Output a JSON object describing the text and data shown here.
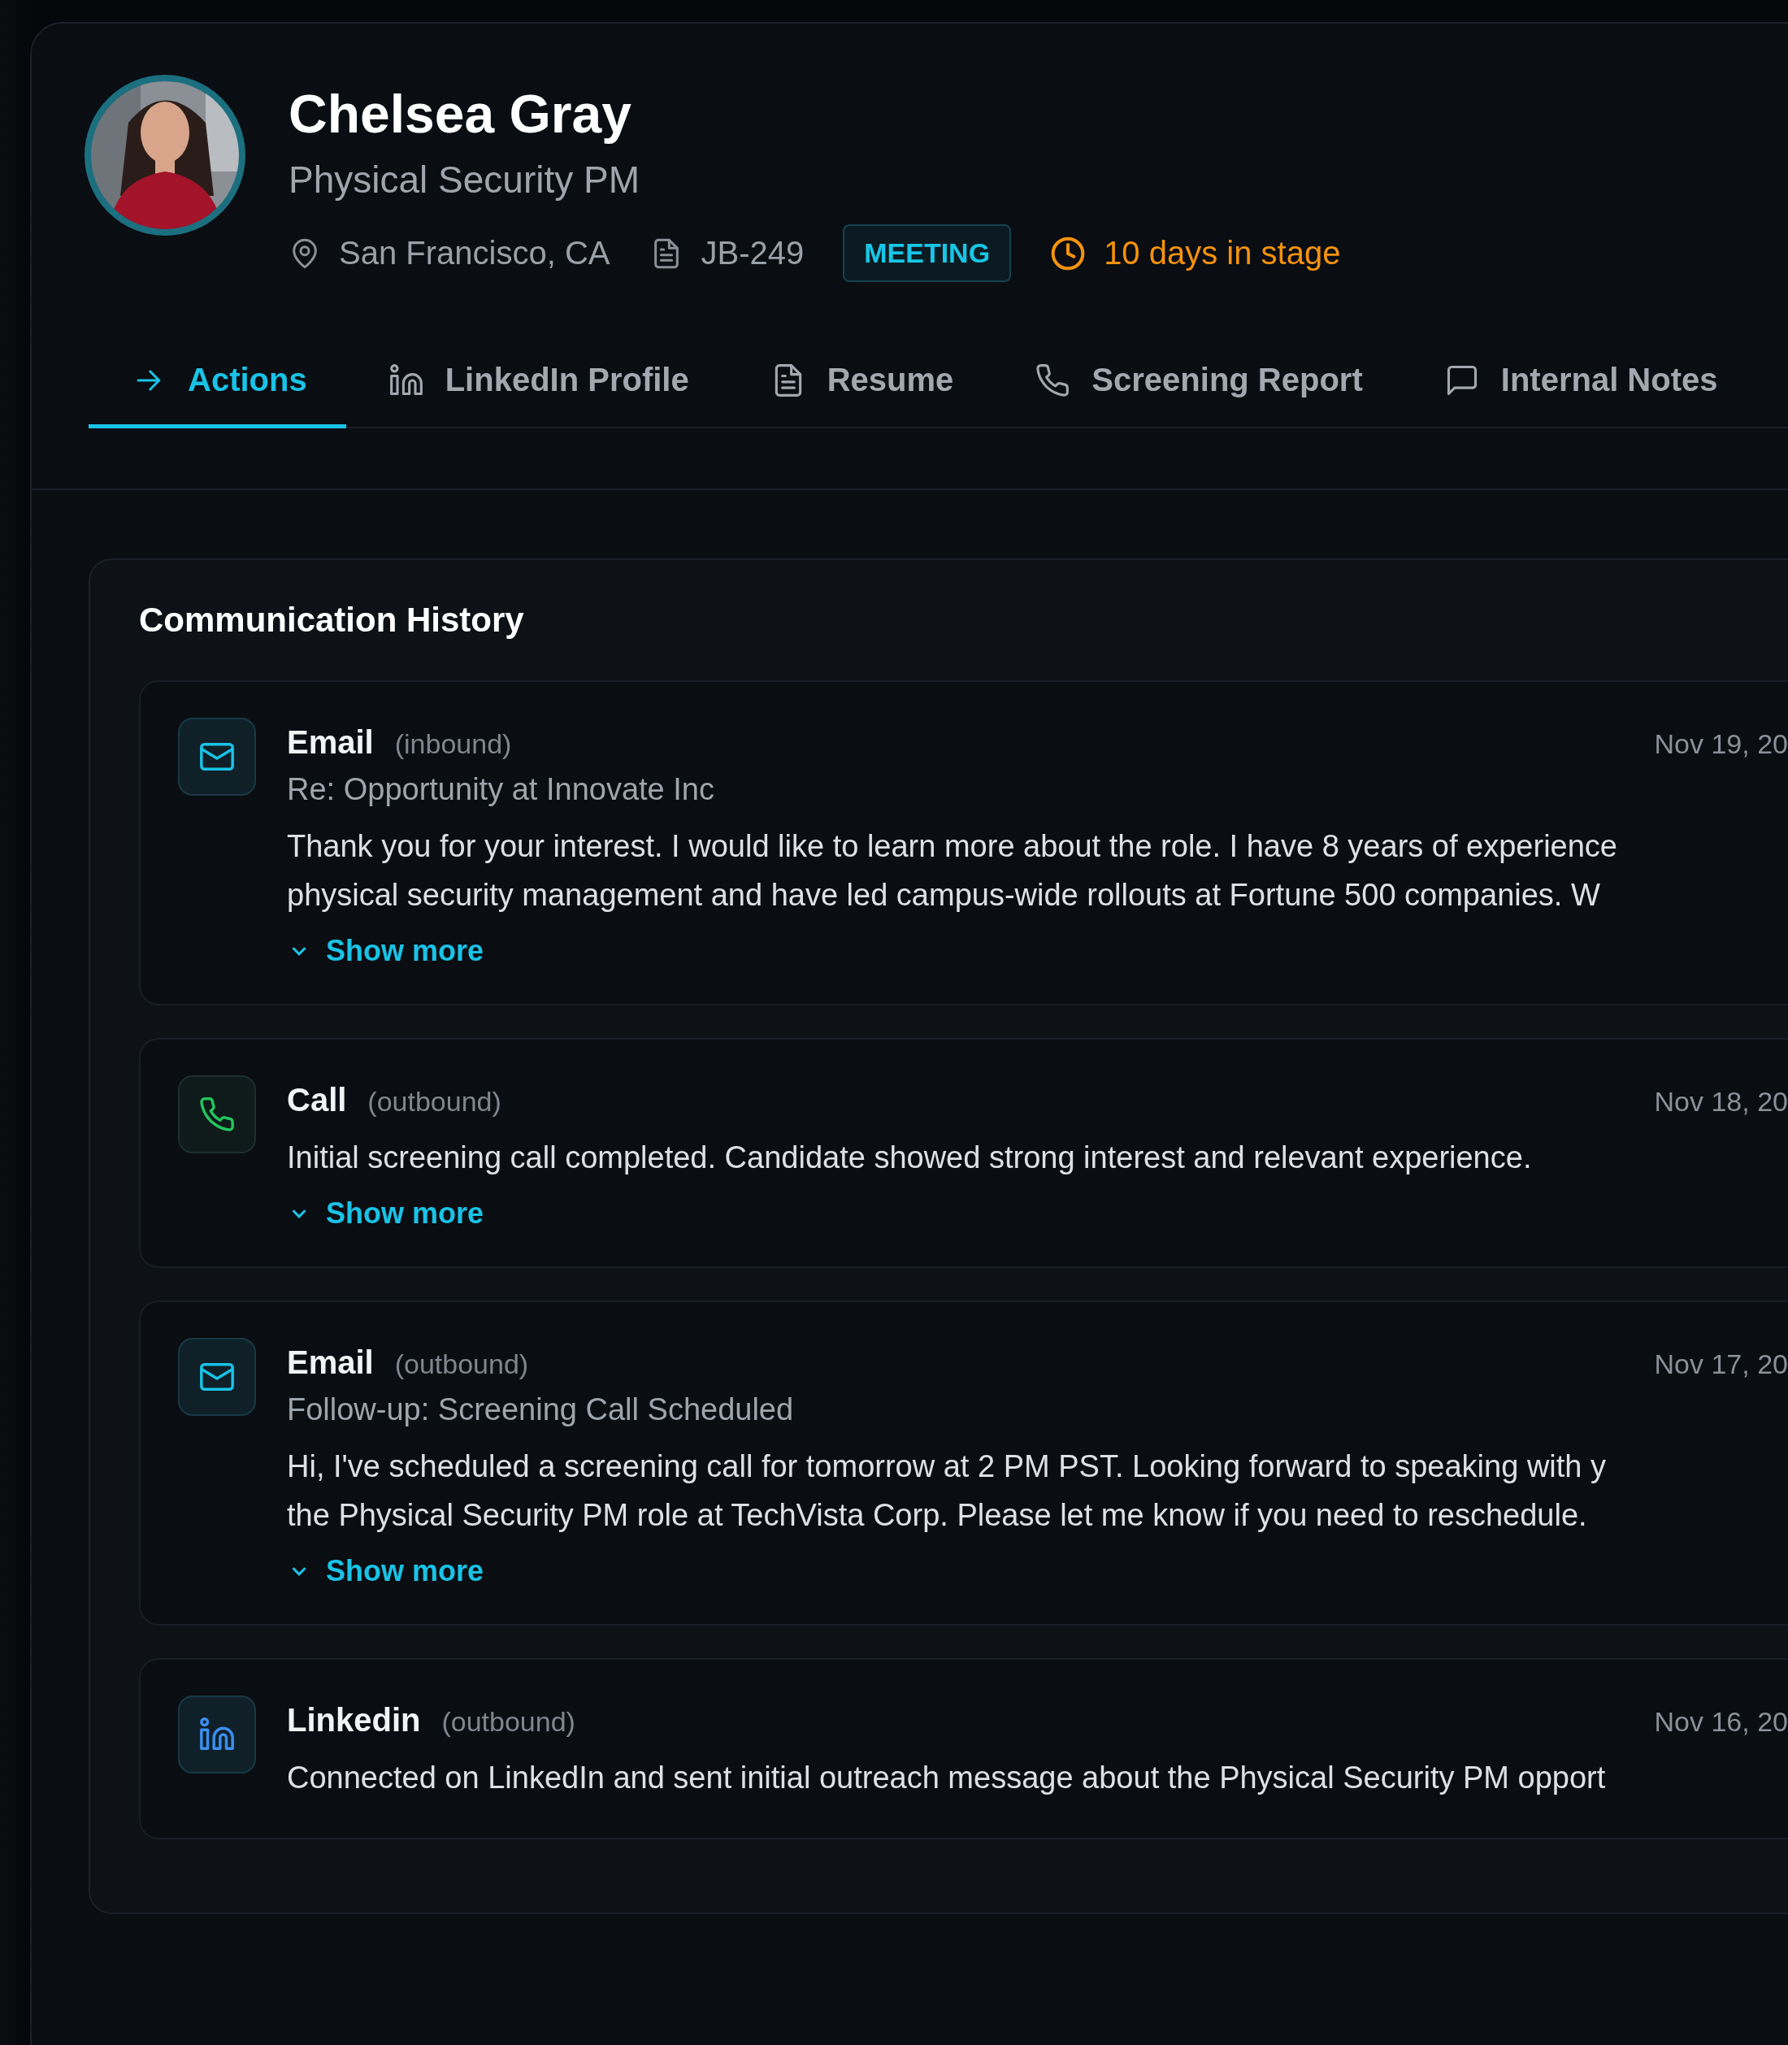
{
  "candidate": {
    "name": "Chelsea Gray",
    "title": "Physical Security PM",
    "location": "San Francisco, CA",
    "job_id": "JB-249",
    "stage": "MEETING",
    "days_in_stage": "10 days in stage"
  },
  "tabs": [
    {
      "label": "Actions",
      "selected": true
    },
    {
      "label": "LinkedIn Profile",
      "selected": false
    },
    {
      "label": "Resume",
      "selected": false
    },
    {
      "label": "Screening Report",
      "selected": false
    },
    {
      "label": "Internal Notes",
      "selected": false
    }
  ],
  "communication_history": {
    "title": "Communication History",
    "items": [
      {
        "kind": "email",
        "type": "Email",
        "direction": "(inbound)",
        "date": "Nov 19, 20",
        "subject": "Re: Opportunity at Innovate Inc",
        "body_lines": [
          "Thank you for your interest. I would like to learn more about the role. I have 8 years of experience",
          "physical security management and have led campus-wide rollouts at Fortune 500 companies. W"
        ],
        "show_more": "Show more"
      },
      {
        "kind": "call",
        "type": "Call",
        "direction": "(outbound)",
        "date": "Nov 18, 20",
        "body_lines": [
          "Initial screening call completed. Candidate showed strong interest and relevant experience."
        ],
        "show_more": "Show more"
      },
      {
        "kind": "email",
        "type": "Email",
        "direction": "(outbound)",
        "date": "Nov 17, 20",
        "subject": "Follow-up: Screening Call Scheduled",
        "body_lines": [
          "Hi, I've scheduled a screening call for tomorrow at 2 PM PST. Looking forward to speaking with y",
          "the Physical Security PM role at TechVista Corp. Please let me know if you need to reschedule."
        ],
        "show_more": "Show more"
      },
      {
        "kind": "linkedin",
        "type": "Linkedin",
        "direction": "(outbound)",
        "date": "Nov 16, 20",
        "body_lines": [
          "Connected on LinkedIn and sent initial outreach message about the Physical Security PM opport"
        ]
      }
    ]
  }
}
